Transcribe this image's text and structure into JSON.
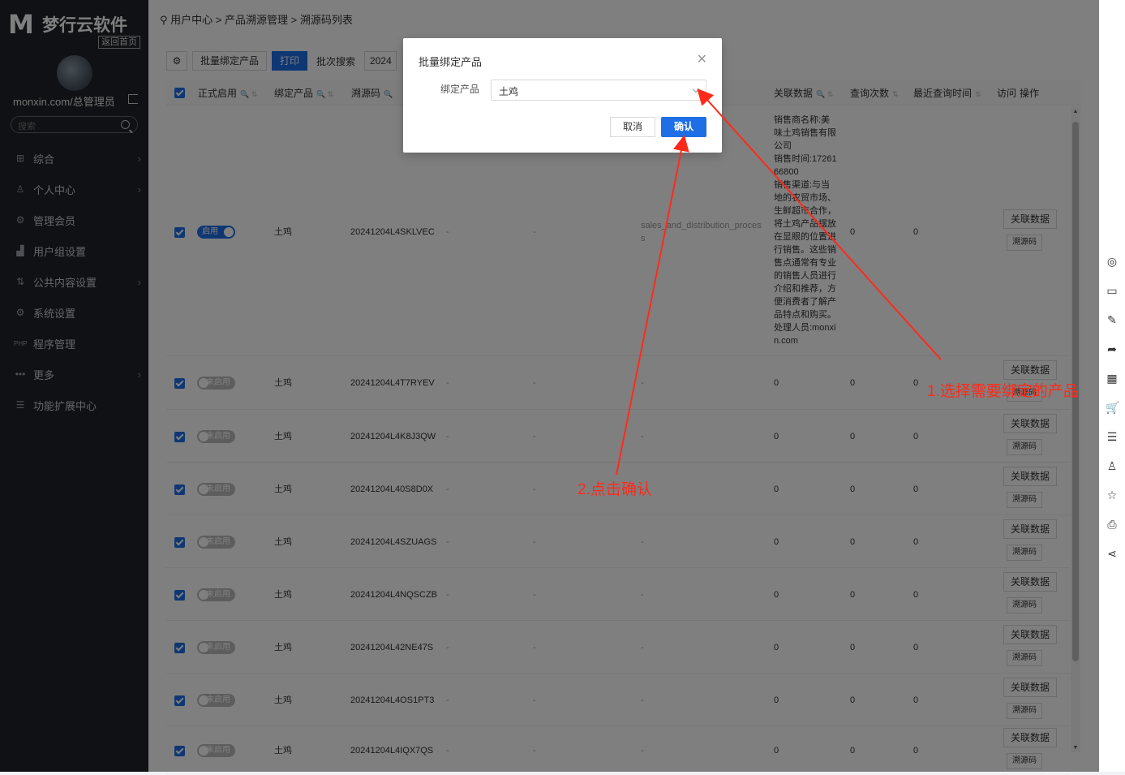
{
  "sidebar": {
    "logo_text": "梦行云软件",
    "home_link": "返回首页",
    "user": "monxin.com/总管理员",
    "search_placeholder": "搜索",
    "menu": [
      {
        "label": "综合",
        "icon": "grid-icon",
        "has_arrow": true
      },
      {
        "label": "个人中心",
        "icon": "user-icon",
        "has_arrow": true
      },
      {
        "label": "管理会员",
        "icon": "gear-icon",
        "has_arrow": false
      },
      {
        "label": "用户组设置",
        "icon": "chart-icon",
        "has_arrow": false
      },
      {
        "label": "公共内容设置",
        "icon": "sort-icon",
        "has_arrow": true
      },
      {
        "label": "系统设置",
        "icon": "settings-icon",
        "has_arrow": false
      },
      {
        "label": "程序管理",
        "icon": "php-icon",
        "has_arrow": false
      },
      {
        "label": "更多",
        "icon": "dots-icon",
        "has_arrow": true
      },
      {
        "label": "功能扩展中心",
        "icon": "list-icon",
        "has_arrow": false
      }
    ]
  },
  "breadcrumb": [
    "用户中心",
    "产品溯源管理",
    "溯源码列表"
  ],
  "toolbar": {
    "batch_bind": "批量绑定产品",
    "print": "打印",
    "batch_search": "批次搜索",
    "batch_value": "2024"
  },
  "table": {
    "headers": [
      "正式启用",
      "绑定产品",
      "溯源码",
      "关联数据",
      "查询次数",
      "最近查询时间",
      "访问",
      "操作"
    ],
    "rows": [
      {
        "status": "启用",
        "on": true,
        "product": "土鸡",
        "code": "20241204L4SKLVEC",
        "c4": "-",
        "c5": "-",
        "c6": "sales_and_distribution_process",
        "related": "销售商名称:美味土鸡销售有限公司\n销售时间:1726166800\n销售渠道:与当地的农贸市场、生鲜超市合作，将土鸡产品摆放在显眼的位置进行销售。这些销售点通常有专业的销售人员进行介绍和推荐，方便消费者了解产品特点和购买。\n处理人员:monxin.com",
        "queries": "0",
        "last": "0"
      },
      {
        "status": "未启用",
        "on": false,
        "product": "土鸡",
        "code": "20241204L4T7RYEV",
        "c4": "-",
        "c5": "-",
        "c6": "-",
        "related": "0",
        "queries": "0",
        "last": "0"
      },
      {
        "status": "未启用",
        "on": false,
        "product": "土鸡",
        "code": "20241204L4K8J3QW",
        "c4": "-",
        "c5": "-",
        "c6": "-",
        "related": "0",
        "queries": "0",
        "last": "0"
      },
      {
        "status": "未启用",
        "on": false,
        "product": "土鸡",
        "code": "20241204L40S8D0X",
        "c4": "-",
        "c5": "-",
        "c6": "-",
        "related": "0",
        "queries": "0",
        "last": "0"
      },
      {
        "status": "未启用",
        "on": false,
        "product": "土鸡",
        "code": "20241204L4SZUAGS",
        "c4": "-",
        "c5": "-",
        "c6": "-",
        "related": "0",
        "queries": "0",
        "last": "0"
      },
      {
        "status": "未启用",
        "on": false,
        "product": "土鸡",
        "code": "20241204L4NQSCZB",
        "c4": "-",
        "c5": "-",
        "c6": "-",
        "related": "0",
        "queries": "0",
        "last": "0"
      },
      {
        "status": "未启用",
        "on": false,
        "product": "土鸡",
        "code": "20241204L42NE47S",
        "c4": "-",
        "c5": "-",
        "c6": "-",
        "related": "0",
        "queries": "0",
        "last": "0"
      },
      {
        "status": "未启用",
        "on": false,
        "product": "土鸡",
        "code": "20241204L4OS1PT3",
        "c4": "-",
        "c5": "-",
        "c6": "-",
        "related": "0",
        "queries": "0",
        "last": "0"
      },
      {
        "status": "未启用",
        "on": false,
        "product": "土鸡",
        "code": "20241204L4IQX7QS",
        "c4": "-",
        "c5": "-",
        "c6": "-",
        "related": "0",
        "queries": "0",
        "last": "0"
      }
    ],
    "action_related": "关联数据",
    "action_trace": "溯源码"
  },
  "dialog": {
    "title": "批量绑定产品",
    "label": "绑定产品",
    "selected": "土鸡",
    "cancel": "取消",
    "confirm": "确认"
  },
  "annotations": {
    "step1": "1.选择需要绑定的产品",
    "step2": "2.点击确认",
    "color": "#ff2a1a"
  },
  "right_toolbar": [
    "wechat-icon",
    "message-icon",
    "edit-icon",
    "share-arrow-icon",
    "qrcode-icon",
    "cart-icon",
    "list-icon",
    "user-icon",
    "star-icon",
    "print-icon",
    "share-icon"
  ]
}
